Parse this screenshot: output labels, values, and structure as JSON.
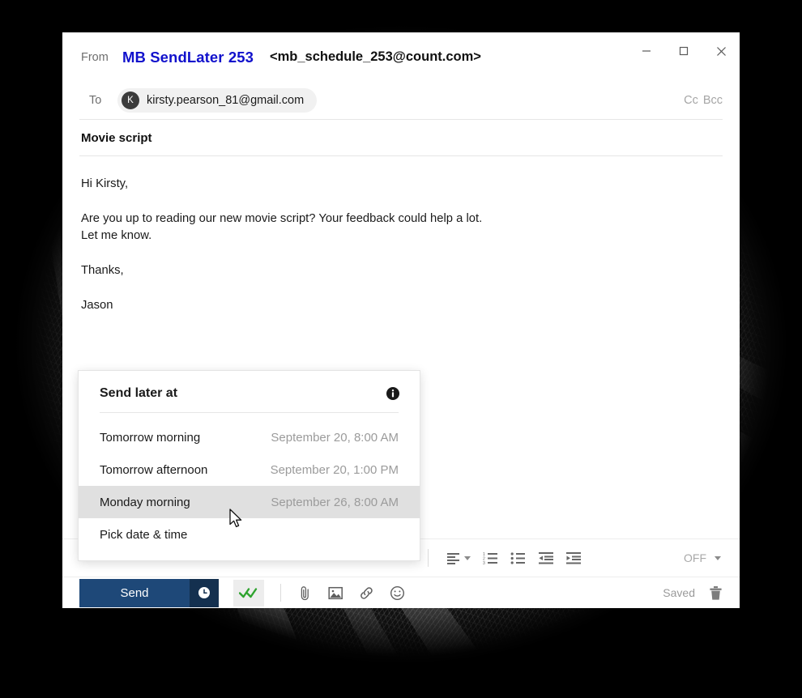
{
  "window": {
    "controls": {
      "minimize_label": "Minimize",
      "maximize_label": "Maximize",
      "close_label": "Close"
    }
  },
  "compose": {
    "from_label": "From",
    "from_name": "MB SendLater 253",
    "from_address": "<mb_schedule_253@count.com>",
    "to_label": "To",
    "recipient_initial": "K",
    "recipient_email": "kirsty.pearson_81@gmail.com",
    "cc_label": "Cc",
    "bcc_label": "Bcc",
    "subject": "Movie script",
    "body": {
      "greeting": "Hi Kirsty,",
      "paragraph_1": "Are you up to reading our new movie script? Your feedback could help a lot.",
      "paragraph_2": "Let me know.",
      "closing": "Thanks,",
      "signature": "Jason"
    }
  },
  "format_toolbar": {
    "align_label": "Align",
    "numbered_list_label": "Numbered list",
    "bulleted_list_label": "Bulleted list",
    "decrease_indent_label": "Decrease indent",
    "increase_indent_label": "Increase indent",
    "tracking_value": "OFF"
  },
  "action_bar": {
    "send_label": "Send",
    "schedule_label": "Schedule send",
    "read_receipt_label": "Read receipt",
    "attach_file_label": "Attach file",
    "insert_image_label": "Insert image",
    "insert_link_label": "Insert link",
    "insert_emoji_label": "Insert emoji",
    "saved_status": "Saved",
    "discard_label": "Discard draft"
  },
  "send_later": {
    "title": "Send later at",
    "info_label": "More information",
    "options": [
      {
        "label": "Tomorrow morning",
        "when": "September 20, 8:00 AM",
        "selected": false
      },
      {
        "label": "Tomorrow afternoon",
        "when": "September 20, 1:00 PM",
        "selected": false
      },
      {
        "label": "Monday morning",
        "when": "September 26, 8:00 AM",
        "selected": true
      },
      {
        "label": "Pick date & time",
        "when": "",
        "selected": false
      }
    ]
  },
  "colors": {
    "accent_blue": "#1e4878",
    "accent_blue_dark": "#14304f",
    "from_name_blue": "#1111cc",
    "check_green": "#2ea32e",
    "highlight_gray": "#e0e0e0"
  }
}
